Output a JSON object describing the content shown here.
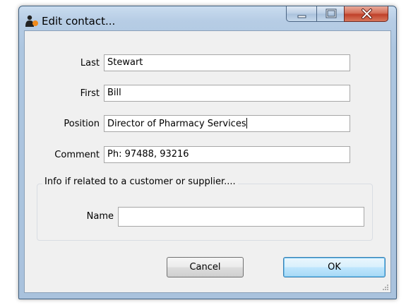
{
  "window": {
    "title": "Edit contact..."
  },
  "form": {
    "last": {
      "label": "Last",
      "value": "Stewart"
    },
    "first": {
      "label": "First",
      "value": "Bill"
    },
    "position": {
      "label": "Position",
      "value": "Director of Pharmacy Services"
    },
    "comment": {
      "label": "Comment",
      "value": "Ph: 97488, 93216"
    }
  },
  "related": {
    "caption": "Info if related to a customer or supplier....",
    "name": {
      "label": "Name",
      "value": ""
    }
  },
  "buttons": {
    "cancel": "Cancel",
    "ok": "OK"
  },
  "icons": {
    "app": "contact-person-icon",
    "minimize": "minimize-icon",
    "maximize": "maximize-icon",
    "close": "close-icon",
    "resize": "resize-grip-icon"
  },
  "colors": {
    "close_button": "#c0412a",
    "default_button_border": "#3c7fb1",
    "title_bar": "#b7cde5"
  }
}
